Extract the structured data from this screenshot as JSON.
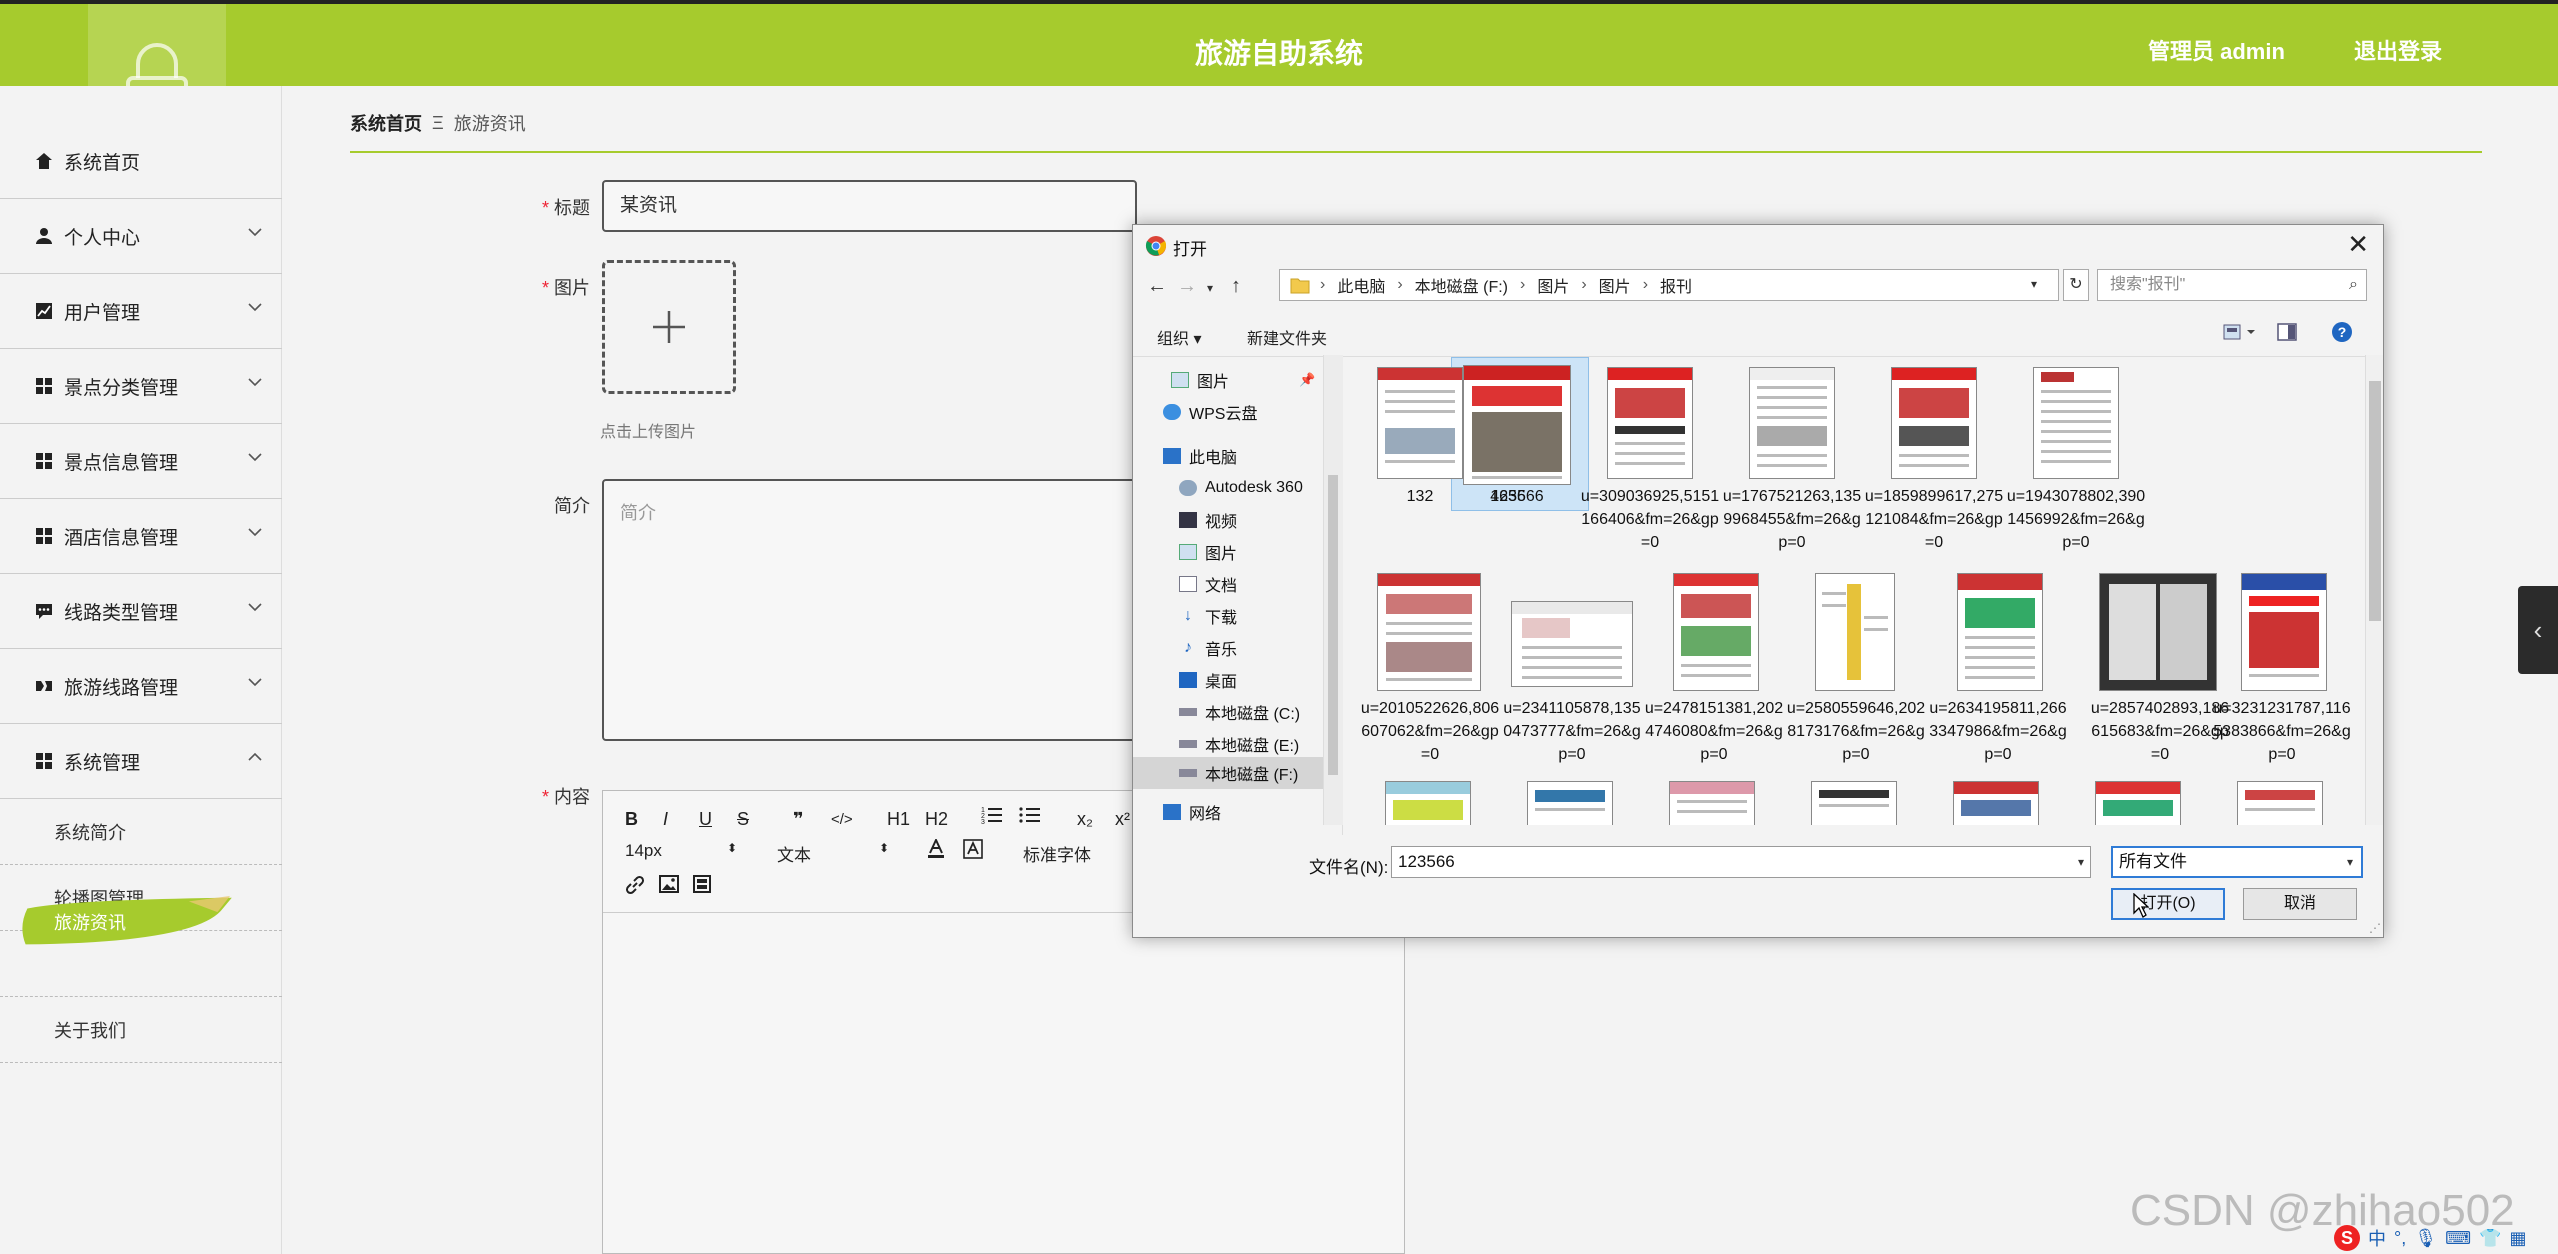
{
  "header": {
    "title": "旅游自助系统",
    "admin_label": "管理员 admin",
    "logout_label": "退出登录"
  },
  "sidebar": {
    "items": [
      {
        "label": "系统首页",
        "icon": "home-icon"
      },
      {
        "label": "个人中心",
        "icon": "user-icon"
      },
      {
        "label": "用户管理",
        "icon": "chart-icon"
      },
      {
        "label": "景点分类管理",
        "icon": "grid-icon"
      },
      {
        "label": "景点信息管理",
        "icon": "grid-icon"
      },
      {
        "label": "酒店信息管理",
        "icon": "grid-icon"
      },
      {
        "label": "线路类型管理",
        "icon": "comment-icon"
      },
      {
        "label": "旅游线路管理",
        "icon": "route-icon"
      },
      {
        "label": "系统管理",
        "icon": "grid-icon"
      }
    ],
    "sub_items": [
      {
        "label": "系统简介"
      },
      {
        "label": "轮播图管理"
      },
      {
        "label": "旅游资讯",
        "active": true
      },
      {
        "label": "关于我们"
      }
    ]
  },
  "breadcrumb": {
    "home": "系统首页",
    "separator": "Ξ",
    "current": "旅游资讯"
  },
  "form": {
    "title_label": "标题",
    "title_value": "某资讯",
    "image_label": "图片",
    "upload_hint": "点击上传图片",
    "intro_label": "简介",
    "intro_placeholder": "简介",
    "content_label": "内容"
  },
  "editor": {
    "font_size": "14px",
    "text_style": "文本",
    "font_family": "标准字体",
    "tools": [
      "B",
      "I",
      "U",
      "S",
      "❞",
      "</>",
      "H1",
      "H2",
      "ol",
      "ul",
      "x₂",
      "x²"
    ]
  },
  "dialog": {
    "title": "打开",
    "path": [
      "此电脑",
      "本地磁盘 (F:)",
      "图片",
      "图片",
      "报刊"
    ],
    "search_placeholder": "搜索\"报刊\"",
    "organize": "组织 ▾",
    "new_folder": "新建文件夹",
    "nav": [
      {
        "label": "图片",
        "icon": "pictures-icon"
      },
      {
        "label": "WPS云盘",
        "icon": "cloud-icon"
      },
      {
        "label": "此电脑",
        "icon": "computer-icon"
      },
      {
        "label": "Autodesk 360",
        "icon": "cloud-icon"
      },
      {
        "label": "视频",
        "icon": "video-icon"
      },
      {
        "label": "图片",
        "icon": "pictures-icon"
      },
      {
        "label": "文档",
        "icon": "document-icon"
      },
      {
        "label": "下载",
        "icon": "download-icon"
      },
      {
        "label": "音乐",
        "icon": "music-icon"
      },
      {
        "label": "桌面",
        "icon": "desktop-icon"
      },
      {
        "label": "本地磁盘 (C:)",
        "icon": "drive-icon"
      },
      {
        "label": "本地磁盘 (E:)",
        "icon": "drive-icon"
      },
      {
        "label": "本地磁盘 (F:)",
        "icon": "drive-icon"
      },
      {
        "label": "网络",
        "icon": "network-icon"
      }
    ],
    "files": [
      {
        "name": "132"
      },
      {
        "name": "4656"
      },
      {
        "name": "123566",
        "selected": true
      },
      {
        "name": "u=309036925,5151166406&fm=26&gp=0"
      },
      {
        "name": "u=1767521263,1359968455&fm=26&gp=0"
      },
      {
        "name": "u=1859899617,275121084&fm=26&gp=0"
      },
      {
        "name": "u=1943078802,3901456992&fm=26&gp=0"
      },
      {
        "name": "u=2010522626,806607062&fm=26&gp=0"
      },
      {
        "name": "u=2341105878,1350473777&fm=26&gp=0"
      },
      {
        "name": "u=2478151381,2024746080&fm=26&gp=0"
      },
      {
        "name": "u=2580559646,2028173176&fm=26&gp=0"
      },
      {
        "name": "u=2634195811,2663347986&fm=26&gp=0"
      },
      {
        "name": "u=2857402893,186615683&fm=26&gp=0"
      },
      {
        "name": "u=3231231787,1165383866&fm=26&gp=0"
      }
    ],
    "filename_label": "文件名(N):",
    "filename_value": "123566",
    "filetype": "所有文件",
    "open_label": "打开(O)",
    "cancel_label": "取消"
  },
  "watermark": "CSDN @zhihao502",
  "ime": {
    "lang": "中"
  },
  "colors": {
    "accent": "#a6cb2d",
    "required": "#e22233",
    "selection": "#cde4f7"
  }
}
